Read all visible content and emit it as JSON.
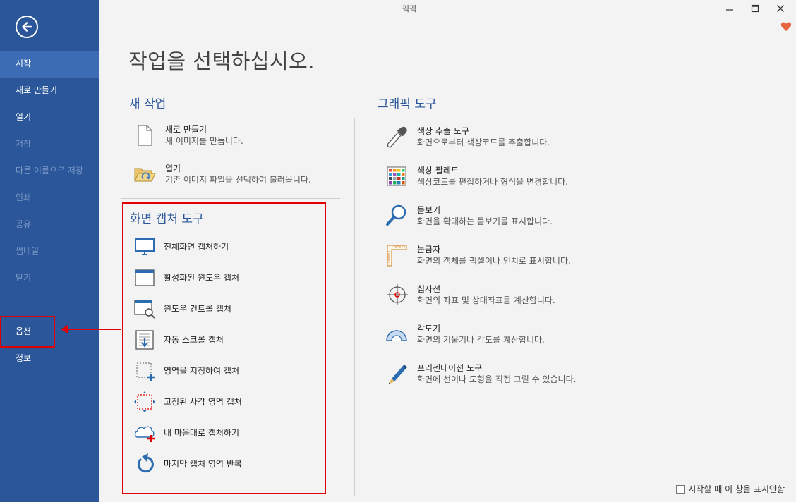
{
  "window": {
    "title": "픽픽"
  },
  "sidebar": {
    "items": [
      {
        "label": "시작",
        "state": "active"
      },
      {
        "label": "새로 만들기",
        "state": "normal"
      },
      {
        "label": "열기",
        "state": "normal"
      },
      {
        "label": "저장",
        "state": "disabled"
      },
      {
        "label": "다른 이름으로 저장",
        "state": "disabled"
      },
      {
        "label": "인쇄",
        "state": "disabled"
      },
      {
        "label": "공유",
        "state": "disabled"
      },
      {
        "label": "썸네일",
        "state": "disabled"
      },
      {
        "label": "닫기",
        "state": "disabled"
      },
      {
        "label": "옵션",
        "state": "highlighted"
      },
      {
        "label": "정보",
        "state": "normal"
      }
    ]
  },
  "main": {
    "heading": "작업을 선택하십시오.",
    "new_task": {
      "title": "새 작업",
      "items": [
        {
          "title": "새로 만들기",
          "desc": "새 이미지를 만듭니다.",
          "icon": "new-file-icon"
        },
        {
          "title": "열기",
          "desc": "기존 이미지 파일을 선택하여 불러옵니다.",
          "icon": "open-folder-icon"
        }
      ]
    },
    "capture_tools": {
      "title": "화면 캡처 도구",
      "items": [
        {
          "label": "전체화면 캡처하기",
          "icon": "monitor-icon"
        },
        {
          "label": "활성화된 윈도우 캡처",
          "icon": "window-icon"
        },
        {
          "label": "윈도우 컨트롤 캡처",
          "icon": "window-control-icon"
        },
        {
          "label": "자동 스크롤 캡처",
          "icon": "scroll-capture-icon"
        },
        {
          "label": "영역을 지정하여 캡처",
          "icon": "region-capture-icon"
        },
        {
          "label": "고정된 사각 영역 캡처",
          "icon": "fixed-region-icon"
        },
        {
          "label": "내 마음대로 캡처하기",
          "icon": "freehand-icon"
        },
        {
          "label": "마지막 캡처 영역 반복",
          "icon": "repeat-icon"
        }
      ]
    },
    "graphic_tools": {
      "title": "그래픽 도구",
      "items": [
        {
          "title": "색상 추출 도구",
          "desc": "화면으로부터 색상코드를 추출합니다.",
          "icon": "eyedropper-icon"
        },
        {
          "title": "색상 팔레트",
          "desc": "색상코드를 편집하거나 형식을 변경합니다.",
          "icon": "palette-icon"
        },
        {
          "title": "돋보기",
          "desc": "화면을 확대하는 돋보기를 표시합니다.",
          "icon": "magnifier-icon"
        },
        {
          "title": "눈금자",
          "desc": "화면의 객체를 픽셀이나 인치로 표시합니다.",
          "icon": "ruler-icon"
        },
        {
          "title": "십자선",
          "desc": "화면의 좌표 및 상대좌표를 계산합니다.",
          "icon": "crosshair-icon"
        },
        {
          "title": "각도기",
          "desc": "화면의 기울기나 각도를 계산합니다.",
          "icon": "protractor-icon"
        },
        {
          "title": "프리젠테이션 도구",
          "desc": "화면에 선이나 도형을 직접 그릴 수 있습니다.",
          "icon": "pen-icon"
        }
      ]
    }
  },
  "footer": {
    "checkbox_label": "시작할 때 이 창을 표시안함",
    "checked": false
  },
  "colors": {
    "sidebar": "#2b579a",
    "accent": "#2b579a",
    "annotation": "#e00000",
    "heart": "#e8643c"
  }
}
